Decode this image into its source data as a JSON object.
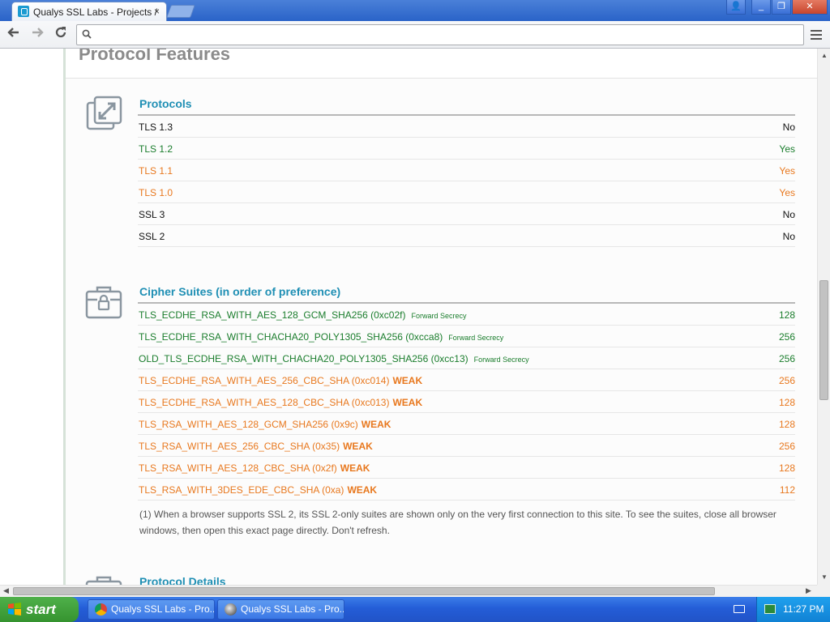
{
  "browser": {
    "tab_title": "Qualys SSL Labs - Projects /",
    "tab_close": "×",
    "window_buttons": {
      "user": "👤",
      "minimize": "_",
      "restore": "❐",
      "close": "✕"
    }
  },
  "page": {
    "heading": "Protocol Features",
    "protocols": {
      "title": "Protocols",
      "rows": [
        {
          "name": "TLS 1.3",
          "value": "No",
          "color": "black"
        },
        {
          "name": "TLS 1.2",
          "value": "Yes",
          "color": "green"
        },
        {
          "name": "TLS 1.1",
          "value": "Yes",
          "color": "orange"
        },
        {
          "name": "TLS 1.0",
          "value": "Yes",
          "color": "orange"
        },
        {
          "name": "SSL 3",
          "value": "No",
          "color": "black"
        },
        {
          "name": "SSL 2",
          "value": "No",
          "color": "black"
        }
      ]
    },
    "ciphers": {
      "title": "Cipher Suites (in order of preference)",
      "rows": [
        {
          "name": "TLS_ECDHE_RSA_WITH_AES_128_GCM_SHA256 (0xc02f)",
          "tag": "Forward Secrecy",
          "weak": "",
          "value": "128",
          "color": "green"
        },
        {
          "name": "TLS_ECDHE_RSA_WITH_CHACHA20_POLY1305_SHA256 (0xcca8)",
          "tag": "Forward Secrecy",
          "weak": "",
          "value": "256",
          "color": "green"
        },
        {
          "name": "OLD_TLS_ECDHE_RSA_WITH_CHACHA20_POLY1305_SHA256 (0xcc13)",
          "tag": "Forward Secrecy",
          "weak": "",
          "value": "256",
          "color": "green"
        },
        {
          "name": "TLS_ECDHE_RSA_WITH_AES_256_CBC_SHA (0xc014)",
          "tag": "",
          "weak": "WEAK",
          "value": "256",
          "color": "orange"
        },
        {
          "name": "TLS_ECDHE_RSA_WITH_AES_128_CBC_SHA (0xc013)",
          "tag": "",
          "weak": "WEAK",
          "value": "128",
          "color": "orange"
        },
        {
          "name": "TLS_RSA_WITH_AES_128_GCM_SHA256 (0x9c)",
          "tag": "",
          "weak": "WEAK",
          "value": "128",
          "color": "orange"
        },
        {
          "name": "TLS_RSA_WITH_AES_256_CBC_SHA (0x35)",
          "tag": "",
          "weak": "WEAK",
          "value": "256",
          "color": "orange"
        },
        {
          "name": "TLS_RSA_WITH_AES_128_CBC_SHA (0x2f)",
          "tag": "",
          "weak": "WEAK",
          "value": "128",
          "color": "orange"
        },
        {
          "name": "TLS_RSA_WITH_3DES_EDE_CBC_SHA (0xa)",
          "tag": "",
          "weak": "WEAK",
          "value": "112",
          "color": "orange"
        }
      ],
      "footnote": "(1) When a browser supports SSL 2, its SSL 2-only suites are shown only on the very first connection to this site. To see the suites, close all browser windows, then open this exact page directly. Don't refresh."
    },
    "protocol_details": {
      "title": "Protocol Details"
    }
  },
  "taskbar": {
    "start_label": "start",
    "items": [
      {
        "label": "Qualys SSL Labs - Pro..."
      },
      {
        "label": "Qualys SSL Labs - Pro..."
      }
    ],
    "clock": "11:27 PM"
  },
  "colors": {
    "green": "#1a7d2c",
    "orange": "#e8781e",
    "black": "#111111",
    "accent": "#1f8fb4"
  }
}
